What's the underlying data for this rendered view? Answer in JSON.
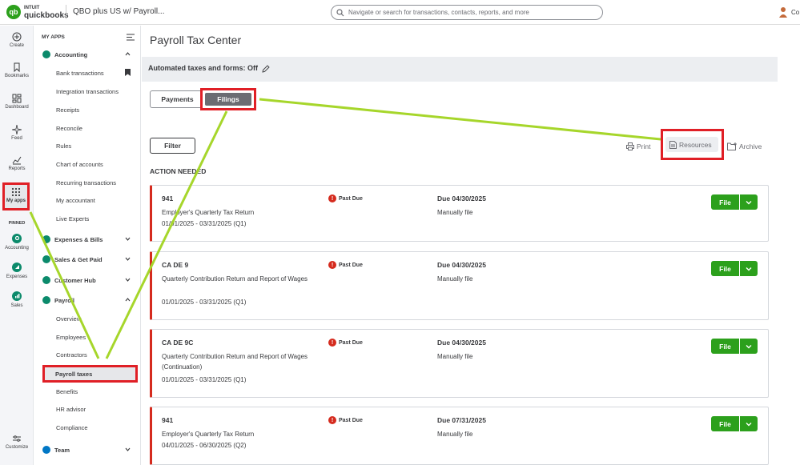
{
  "topbar": {
    "logo_mark": "qb",
    "logo_intuit": "INTUIT",
    "logo_name": "quickbooks",
    "company": "QBO plus US w/ Payroll...",
    "search_placeholder": "Navigate or search for transactions, contacts, reports, and more",
    "user_short": "Co"
  },
  "rail": {
    "items": [
      {
        "label": "Create",
        "icon": "plus-circle-icon"
      },
      {
        "label": "Bookmarks",
        "icon": "bookmark-icon"
      },
      {
        "label": "Dashboard",
        "icon": "dashboard-icon"
      },
      {
        "label": "Feed",
        "icon": "sparkle-icon"
      },
      {
        "label": "Reports",
        "icon": "chart-line-icon"
      }
    ],
    "my_apps": "My apps",
    "pinned_header": "PINNED",
    "pinned": [
      {
        "label": "Accounting",
        "color": "#0b8a6b"
      },
      {
        "label": "Expenses",
        "color": "#0b8a6b"
      },
      {
        "label": "Sales",
        "color": "#0b8a6b"
      }
    ],
    "customize": "Customize"
  },
  "sidebar": {
    "header": "MY APPS",
    "accounting": "Accounting",
    "accounting_items": [
      "Bank transactions",
      "Integration transactions",
      "Receipts",
      "Reconcile",
      "Rules",
      "Chart of accounts",
      "Recurring transactions",
      "My accountant",
      "Live Experts"
    ],
    "groups": [
      "Expenses & Bills",
      "Sales & Get Paid",
      "Customer Hub"
    ],
    "payroll": "Payroll",
    "payroll_items": [
      "Overview",
      "Employees",
      "Contractors"
    ],
    "active": "Payroll taxes",
    "payroll_items_after": [
      "Benefits",
      "HR advisor",
      "Compliance"
    ],
    "team": "Team"
  },
  "main": {
    "title": "Payroll Tax Center",
    "auto_text": "Automated taxes and forms: Off",
    "tabs": {
      "payments": "Payments",
      "filings": "Filings"
    },
    "filter": "Filter",
    "print": "Print",
    "resources": "Resources",
    "archive": "Archive",
    "action_needed": "ACTION NEEDED",
    "file_label": "File",
    "cards": [
      {
        "form": "941",
        "desc": "Employer's Quarterly Tax Return",
        "period": "01/01/2025 - 03/31/2025 (Q1)",
        "status": "Past Due",
        "due": "Due 04/30/2025",
        "method": "Manually file"
      },
      {
        "form": "CA DE 9",
        "desc": "Quarterly Contribution Return and Report of Wages",
        "period": "01/01/2025 - 03/31/2025 (Q1)",
        "status": "Past Due",
        "due": "Due 04/30/2025",
        "method": "Manually file"
      },
      {
        "form": "CA DE 9C",
        "desc": "Quarterly Contribution Return and Report of Wages (Continuation)",
        "period": "01/01/2025 - 03/31/2025 (Q1)",
        "status": "Past Due",
        "due": "Due 04/30/2025",
        "method": "Manually file"
      },
      {
        "form": "941",
        "desc": "Employer's Quarterly Tax Return",
        "period": "04/01/2025 - 06/30/2025 (Q2)",
        "status": "Past Due",
        "due": "Due 07/31/2025",
        "method": "Manually file"
      }
    ]
  },
  "colors": {
    "brand_green": "#2ca01c",
    "highlight_red": "#e01f26",
    "annotation_green": "#a6d62b",
    "past_due_red": "#d52b1e"
  }
}
